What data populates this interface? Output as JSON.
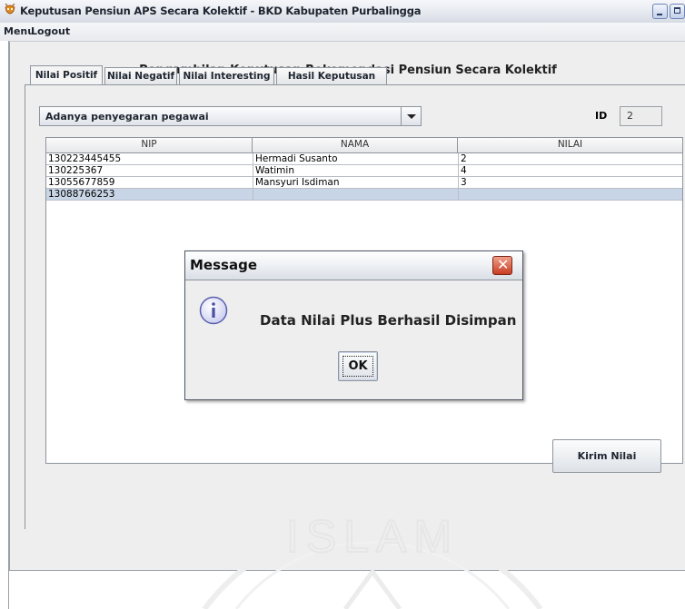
{
  "window": {
    "title": "Keputusan Pensiun APS Secara Kolektif - BKD Kabupaten Purbalingga",
    "icon": "app-icon"
  },
  "menubar": {
    "items": [
      {
        "label": "Menu"
      },
      {
        "label": "Logout"
      }
    ]
  },
  "main": {
    "heading": "Pengambilan Keputusan Rekomendasi Pensiun Secara Kolektif",
    "tabs": [
      {
        "label": "Nilai Positif",
        "active": true
      },
      {
        "label": "Nilai Negatif",
        "active": false
      },
      {
        "label": "Nilai Interesting",
        "active": false
      },
      {
        "label": "Hasil Keputusan",
        "active": false
      }
    ],
    "criteria_select": {
      "value": "Adanya penyegaran pegawai"
    },
    "id_label": "ID",
    "id_value": "2",
    "table": {
      "columns": [
        "NIP",
        "NAMA",
        "NILAI"
      ],
      "rows": [
        {
          "nip": "130223445455",
          "nama": "Hermadi Susanto",
          "nilai": "2",
          "selected": false
        },
        {
          "nip": "130225367",
          "nama": "Watimin",
          "nilai": "4",
          "selected": false
        },
        {
          "nip": "13055677859",
          "nama": "Mansyuri Isdiman",
          "nilai": "3",
          "selected": false
        },
        {
          "nip": "13088766253",
          "nama": "",
          "nilai": "",
          "selected": true
        }
      ]
    },
    "submit_label": "Kirim Nilai",
    "watermark_text": "ISLAM"
  },
  "dialog": {
    "title": "Message",
    "message": "Data Nilai Plus Berhasil Disimpan",
    "ok_label": "OK",
    "icon": "info-icon"
  },
  "colors": {
    "selection": "#c8d5e6",
    "panel": "#eeeeee",
    "close_red": "#c93d23"
  }
}
